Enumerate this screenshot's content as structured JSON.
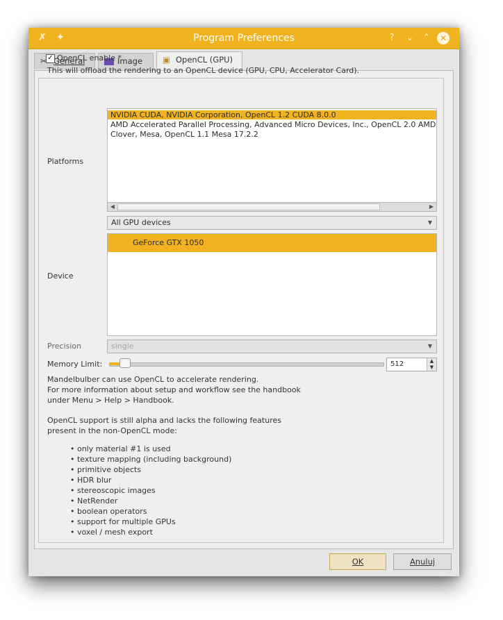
{
  "window": {
    "title": "Program Preferences",
    "controls": {
      "help": "?",
      "minimize": "⌄",
      "maximize": "⌃",
      "close": "✕"
    },
    "accent": "#f0b31f"
  },
  "tabs": [
    {
      "label": "General",
      "icon": "tools-icon",
      "active": false
    },
    {
      "label": "Image",
      "icon": "image-icon",
      "active": false
    },
    {
      "label": "OpenCL (GPU)",
      "icon": "gpu-icon",
      "active": true
    }
  ],
  "opencl": {
    "enable_label": "OpenCL enable *",
    "enable_checked": true,
    "description": "This will offload the rendering to an OpenCL device (GPU, CPU, Accelerator Card).",
    "platforms_label": "Platforms",
    "platforms": [
      "NVIDIA CUDA, NVIDIA Corporation, OpenCL 1.2 CUDA 8.0.0",
      "AMD Accelerated Parallel Processing, Advanced Micro Devices, Inc., OpenCL 2.0 AMD",
      "Clover, Mesa, OpenCL 1.1 Mesa 17.2.2"
    ],
    "selected_platform": 0,
    "device_type": "All GPU devices",
    "device_label": "Device",
    "devices": [
      "GeForce GTX 1050"
    ],
    "selected_device": 0,
    "precision_label": "Precision",
    "precision_value": "single",
    "memory_label": "Memory Limit:",
    "memory_value": "512",
    "info_lines": [
      "Mandelbulber can use OpenCL to accelerate rendering.",
      "For more information about setup and workflow see the handbook",
      "under Menu > Help > Handbook."
    ],
    "alpha_lines": [
      "OpenCL support is still alpha and lacks the following features",
      "present in the non-OpenCL mode:"
    ],
    "features": [
      "• only material #1 is used",
      "• texture mapping (including background)",
      "• primitive objects",
      "• HDR blur",
      "• stereoscopic images",
      "• NetRender",
      "• boolean operators",
      "• support for multiple GPUs",
      "• voxel / mesh export"
    ]
  },
  "buttons": {
    "ok": "OK",
    "cancel": "Anuluj"
  }
}
